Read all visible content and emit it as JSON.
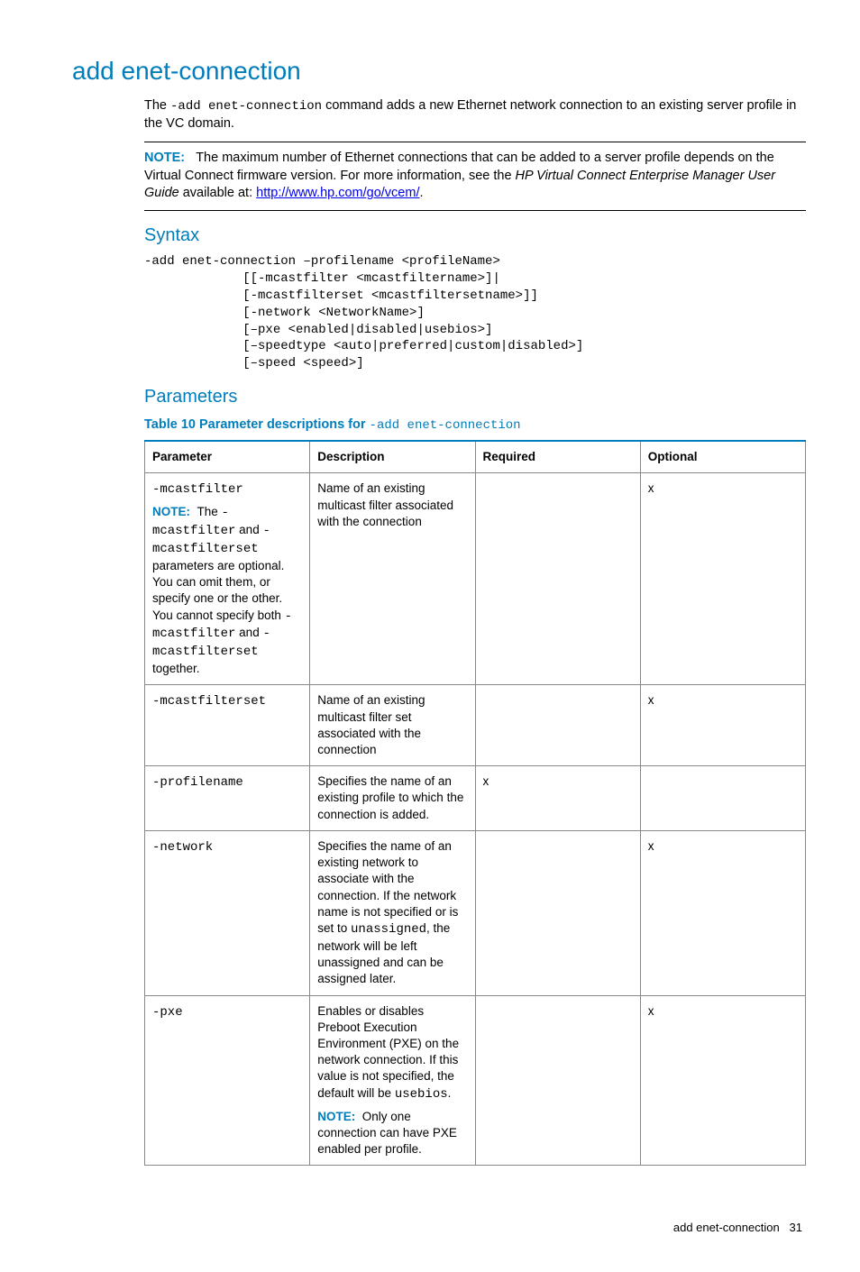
{
  "title": "add enet-connection",
  "intro": {
    "prefix": "The ",
    "cmd": "-add enet-connection",
    "suffix": " command adds a new Ethernet network connection to an existing server profile in the VC domain."
  },
  "note": {
    "label": "NOTE:",
    "text_part1": "The maximum number of Ethernet connections that can be added to a server profile depends on the Virtual Connect firmware version. For more information, see the ",
    "italic": "HP Virtual Connect Enterprise Manager User Guide",
    "text_part2": " available at: ",
    "link": "http://www.hp.com/go/vcem/",
    "period": "."
  },
  "syntax_heading": "Syntax",
  "syntax_block": "-add enet-connection –profilename <profileName>\n             [[-mcastfilter <mcastfiltername>]|\n             [-mcastfilterset <mcastfiltersetname>]]\n             [-network <NetworkName>]\n             [–pxe <enabled|disabled|usebios>]\n             [–speedtype <auto|preferred|custom|disabled>]\n             [–speed <speed>]",
  "parameters_heading": "Parameters",
  "table_caption": {
    "lead": "Table 10 Parameter descriptions for ",
    "code": "-add enet-connection"
  },
  "table": {
    "headers": [
      "Parameter",
      "Description",
      "Required",
      "Optional"
    ],
    "rows": [
      {
        "param_code1": "-mcastfilter",
        "note_label": "NOTE:",
        "note_t1": "The ",
        "note_c1": "-mcastfilter",
        "note_t2": " and ",
        "note_c2": "-mcastfilterset",
        "note_t3": " parameters are optional. You can omit them, or specify one or the other. You cannot specify both ",
        "note_c3": "-mcastfilter",
        "note_t4": " and ",
        "note_c4": "-mcastfilterset",
        "note_t5": " together.",
        "desc": "Name of an existing multicast filter associated with the connection",
        "req": "",
        "opt": "x"
      },
      {
        "param_code1": "-mcastfilterset",
        "desc": "Name of an existing multicast filter set associated with the connection",
        "req": "",
        "opt": "x"
      },
      {
        "param_code1": "-profilename",
        "desc": "Specifies the name of an existing profile to which the connection is added.",
        "req": "x",
        "opt": ""
      },
      {
        "param_code1": "-network",
        "desc_t1": "Specifies the name of an existing network to associate with the connection. If the network name is not specified or is set to ",
        "desc_c1": "unassigned",
        "desc_t2": ", the network will be left unassigned and can be assigned later.",
        "req": "",
        "opt": "x"
      },
      {
        "param_code1": "-pxe",
        "desc_t1": "Enables or disables Preboot Execution Environment (PXE) on the network connection. If this value is not specified, the default will be ",
        "desc_c1": "usebios",
        "desc_t2": ".",
        "note_label": "NOTE:",
        "note_text": "Only one connection can have PXE enabled per profile.",
        "req": "",
        "opt": "x"
      }
    ]
  },
  "footer": {
    "title": "add enet-connection",
    "page": "31"
  },
  "chart_data": {
    "type": "table",
    "title": "Table 10 Parameter descriptions for -add enet-connection",
    "columns": [
      "Parameter",
      "Description",
      "Required",
      "Optional"
    ],
    "rows": [
      [
        "-mcastfilter",
        "Name of an existing multicast filter associated with the connection",
        "",
        "x"
      ],
      [
        "-mcastfilterset",
        "Name of an existing multicast filter set associated with the connection",
        "",
        "x"
      ],
      [
        "-profilename",
        "Specifies the name of an existing profile to which the connection is added.",
        "x",
        ""
      ],
      [
        "-network",
        "Specifies the name of an existing network to associate with the connection. If the network name is not specified or is set to unassigned, the network will be left unassigned and can be assigned later.",
        "",
        "x"
      ],
      [
        "-pxe",
        "Enables or disables Preboot Execution Environment (PXE) on the network connection. If this value is not specified, the default will be usebios.",
        "",
        "x"
      ]
    ]
  }
}
